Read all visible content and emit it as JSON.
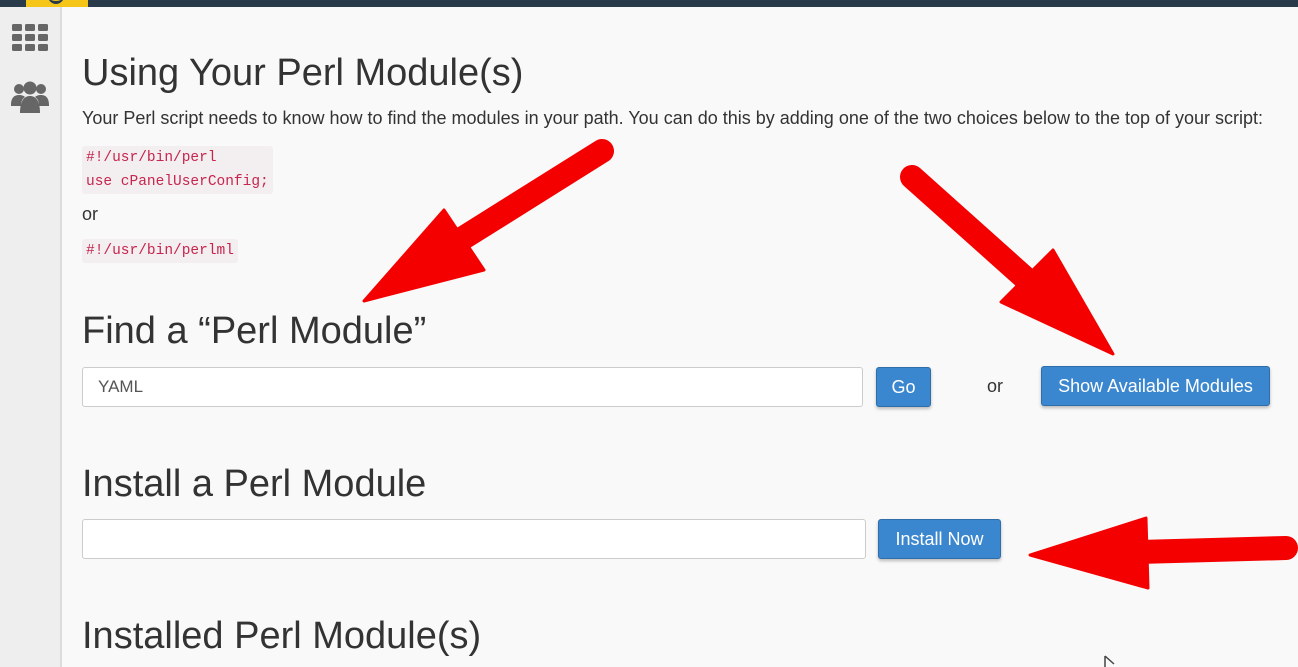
{
  "sidebar": {
    "icons": [
      "grid-icon",
      "users-icon"
    ]
  },
  "using": {
    "title": "Using Your Perl Module(s)",
    "description": "Your Perl script needs to know how to find the modules in your path. You can do this by adding one of the two choices below to the top of your script:",
    "code_1": "#!/usr/bin/perl\nuse cPanelUserConfig;",
    "or_label": "or",
    "code_2": "#!/usr/bin/perlml"
  },
  "find": {
    "title": "Find a “Perl Module”",
    "search_value": "YAML",
    "go_label": "Go",
    "or_label": "or",
    "show_label": "Show Available Modules"
  },
  "install": {
    "title": "Install a Perl Module",
    "input_value": "",
    "install_label": "Install Now"
  },
  "installed": {
    "title": "Installed Perl Module(s)"
  },
  "colors": {
    "accent": "#3b87cf",
    "annotation_arrow": "#f50000",
    "code_text": "#c7254e",
    "topbar": "#293a4a",
    "logo": "#f5c518"
  }
}
